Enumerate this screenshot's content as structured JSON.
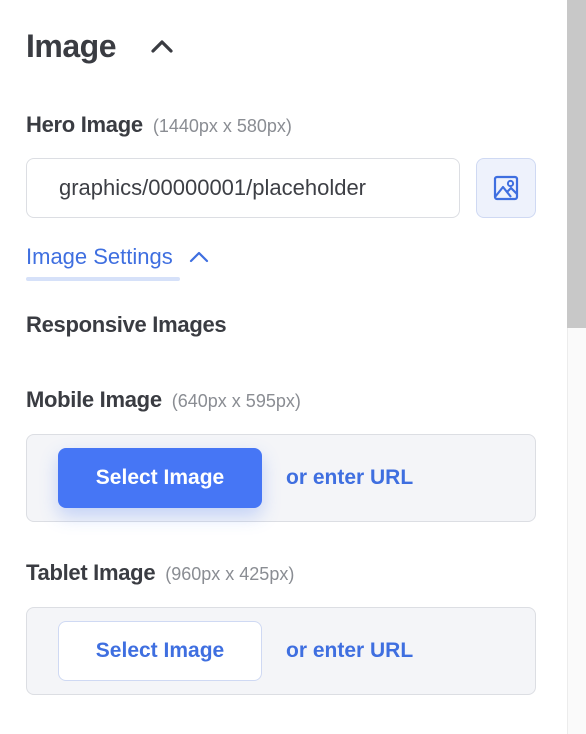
{
  "section": {
    "title": "Image"
  },
  "hero": {
    "label": "Hero Image",
    "hint": "(1440px x 580px)",
    "value": "graphics/00000001/placeholder"
  },
  "settings": {
    "link_label": "Image Settings"
  },
  "responsive": {
    "heading": "Responsive Images"
  },
  "mobile": {
    "label": "Mobile Image",
    "hint": "(640px x 595px)",
    "select_label": "Select Image",
    "url_label": "or enter URL"
  },
  "tablet": {
    "label": "Tablet Image",
    "hint": "(960px x 425px)",
    "select_label": "Select Image",
    "url_label": "or enter URL"
  },
  "icons": {
    "collapse": "chevron-up-icon",
    "media": "image-icon",
    "settings_toggle": "chevron-up-icon"
  },
  "colors": {
    "accent": "#3f6fe0",
    "primary_button": "#4676f5",
    "text": "#3a3c42",
    "muted": "#8a8d93",
    "box_background": "#f4f5f8"
  }
}
